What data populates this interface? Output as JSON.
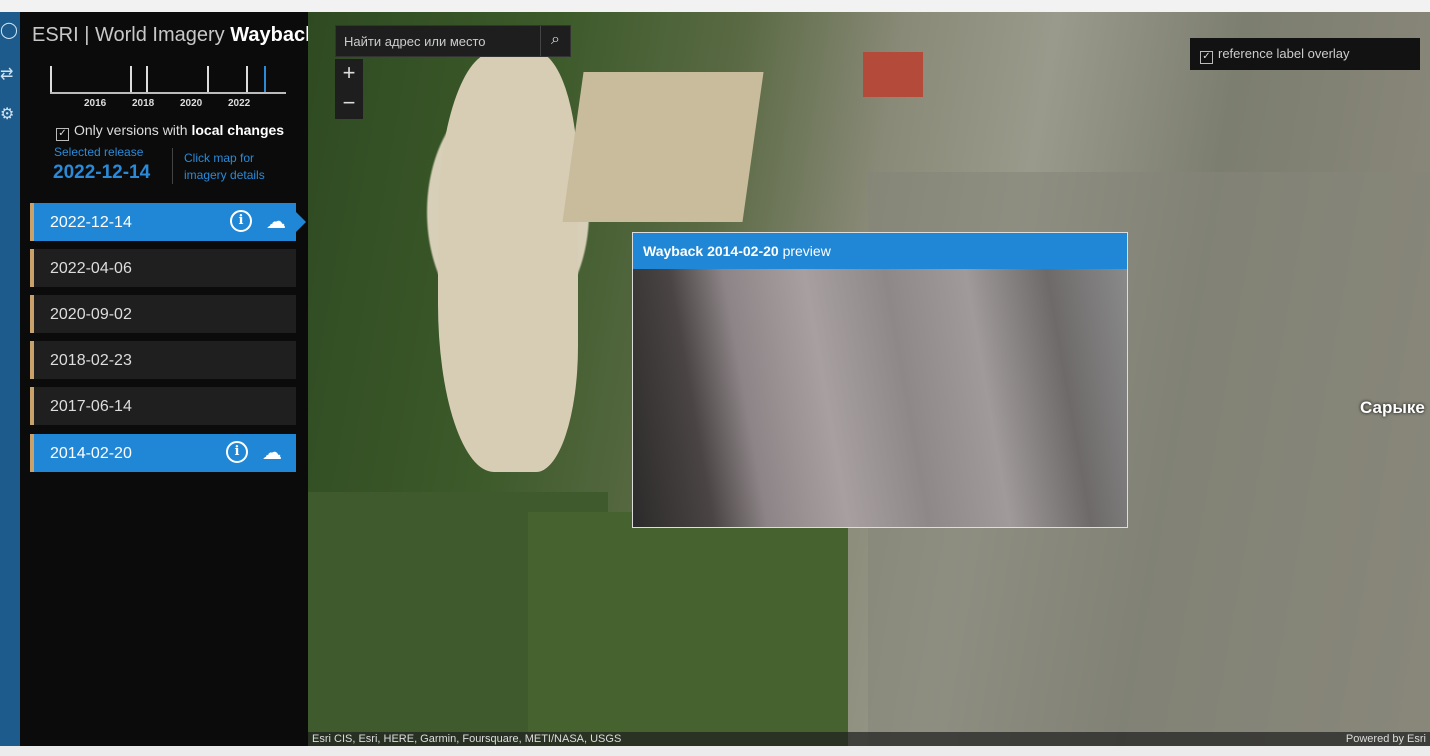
{
  "app": {
    "title_prefix": "ESRI | World Imagery ",
    "title_bold": "Wayback"
  },
  "timeline": {
    "years": [
      "2016",
      "2018",
      "2020",
      "2022"
    ]
  },
  "filter": {
    "label_prefix": "Only versions with ",
    "label_bold": "local changes",
    "checked": true
  },
  "selected": {
    "label": "Selected release",
    "date": "2022-12-14",
    "hint": "Click map for imagery details"
  },
  "releases": [
    {
      "date": "2022-12-14",
      "state": "selected"
    },
    {
      "date": "2022-04-06",
      "state": "normal"
    },
    {
      "date": "2020-09-02",
      "state": "normal"
    },
    {
      "date": "2018-02-23",
      "state": "normal"
    },
    {
      "date": "2017-06-14",
      "state": "normal"
    },
    {
      "date": "2014-02-20",
      "state": "hover"
    }
  ],
  "map": {
    "search_placeholder": "Найти адрес или место",
    "zoom_in": "+",
    "zoom_out": "−",
    "overlay_label": "reference label overlay",
    "place_label": "Сарыке",
    "preview_title_bold": "Wayback 2014-02-20",
    "preview_title_rest": " preview",
    "attribution": "Esri CIS, Esri, HERE, Garmin, Foursquare, METI/NASA, USGS",
    "powered": "Powered by Esri"
  },
  "colors": {
    "accent": "#1f87d6",
    "sidebar": "#0b0b0b"
  }
}
